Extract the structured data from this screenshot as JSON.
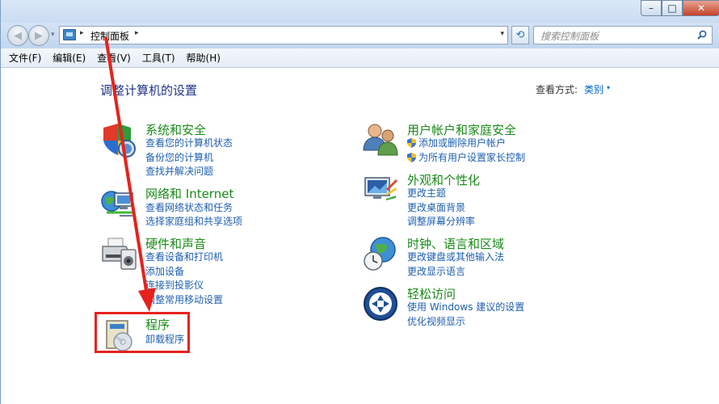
{
  "window": {
    "caption": {
      "minimize": "–",
      "maximize": "□",
      "close": "✕"
    }
  },
  "nav": {
    "back_glyph": "◀",
    "forward_glyph": "▶",
    "address_path": "控制面板",
    "address_sep": "▸",
    "dropdown_glyph": "▾",
    "refresh_glyph": "⟲",
    "search_placeholder": "搜索控制面板"
  },
  "menu": {
    "items": [
      "文件(F)",
      "编辑(E)",
      "查看(V)",
      "工具(T)",
      "帮助(H)"
    ]
  },
  "content": {
    "heading": "调整计算机的设置",
    "view_by_label": "查看方式:",
    "view_by_value": "类别",
    "view_by_arrow": "▾"
  },
  "categories": {
    "system": {
      "title": "系统和安全",
      "links": [
        "查看您的计算机状态",
        "备份您的计算机",
        "查找并解决问题"
      ]
    },
    "network": {
      "title": "网络和 Internet",
      "links": [
        "查看网络状态和任务",
        "选择家庭组和共享选项"
      ]
    },
    "hardware": {
      "title": "硬件和声音",
      "links": [
        "查看设备和打印机",
        "添加设备",
        "连接到投影仪",
        "调整常用移动设置"
      ]
    },
    "programs": {
      "title": "程序",
      "links": [
        "卸载程序"
      ]
    },
    "users": {
      "title": "用户帐户和家庭安全",
      "links": [
        "添加或删除用户帐户",
        "为所有用户设置家长控制"
      ]
    },
    "appearance": {
      "title": "外观和个性化",
      "links": [
        "更改主题",
        "更改桌面背景",
        "调整屏幕分辨率"
      ]
    },
    "clock": {
      "title": "时钟、语言和区域",
      "links": [
        "更改键盘或其他输入法",
        "更改显示语言"
      ]
    },
    "ease": {
      "title": "轻松访问",
      "links": [
        "使用 Windows 建议的设置",
        "优化视频显示"
      ]
    }
  },
  "colors": {
    "title_green": "#1a8a1a",
    "link_blue": "#1d5fb0",
    "heading_blue": "#1e3287",
    "annotation_red": "#e6221d"
  }
}
